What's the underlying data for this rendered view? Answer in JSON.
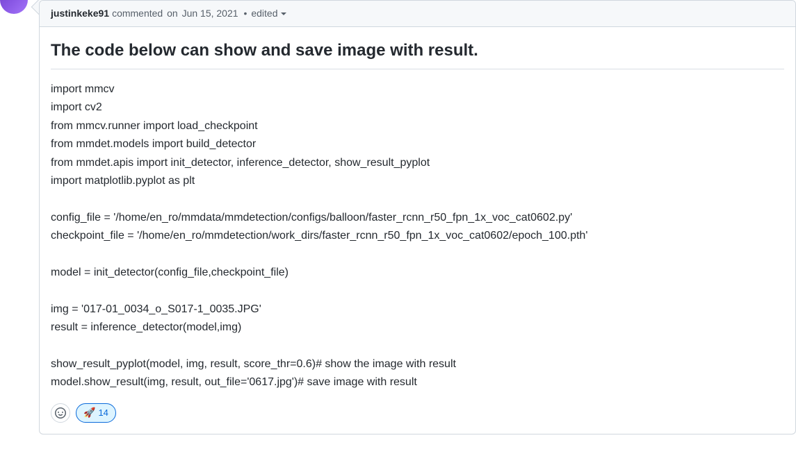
{
  "comment": {
    "author": "justinkeke91",
    "action_text": "commented",
    "on_text": "on",
    "date": "Jun 15, 2021",
    "separator": "•",
    "edited_label": "edited",
    "title": "The code below can show and save image with result.",
    "code_lines": [
      "import mmcv",
      "import cv2",
      "from mmcv.runner import load_checkpoint",
      "from mmdet.models import build_detector",
      "from mmdet.apis import init_detector, inference_detector, show_result_pyplot",
      "import matplotlib.pyplot as plt",
      "",
      "config_file = '/home/en_ro/mmdata/mmdetection/configs/balloon/faster_rcnn_r50_fpn_1x_voc_cat0602.py'",
      "checkpoint_file = '/home/en_ro/mmdetection/work_dirs/faster_rcnn_r50_fpn_1x_voc_cat0602/epoch_100.pth'",
      "",
      "model = init_detector(config_file,checkpoint_file)",
      "",
      "img = '017-01_0034_o_S017-1_0035.JPG'",
      "result = inference_detector(model,img)",
      "",
      "show_result_pyplot(model, img, result, score_thr=0.6)# show the image with result",
      "model.show_result(img, result, out_file='0617.jpg')# save image with result"
    ]
  },
  "reactions": {
    "rocket": {
      "emoji": "🚀",
      "count": "14"
    }
  }
}
